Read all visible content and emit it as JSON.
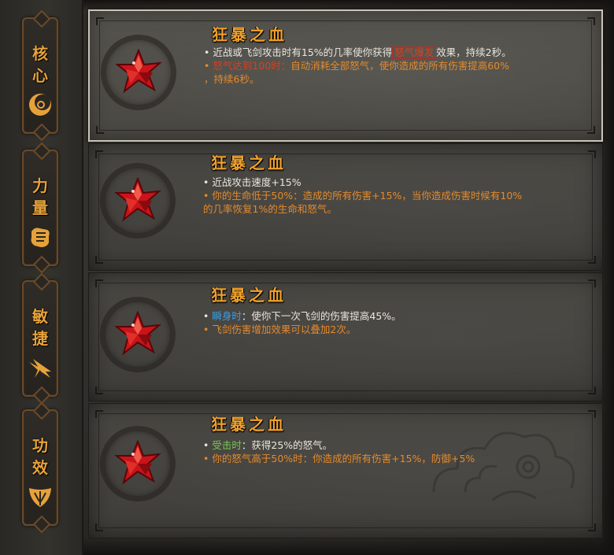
{
  "tabs": [
    {
      "label_1": "核",
      "label_2": "心",
      "icon": "crescent-swirl-icon"
    },
    {
      "label_1": "力",
      "label_2": "量",
      "icon": "fist-icon"
    },
    {
      "label_1": "敏",
      "label_2": "捷",
      "icon": "flying-sword-icon"
    },
    {
      "label_1": "功",
      "label_2": "效",
      "icon": "leaf-emblem-icon"
    }
  ],
  "panels": [
    {
      "title": "狂暴之血",
      "gem_icon": "red-crystal-star-icon",
      "lines": [
        {
          "a": "近战或飞剑攻击时有15%的几率使你获得",
          "b": "怒气爆发",
          "c": "效果，持续2秒。"
        },
        {
          "a": "怒气达到100时：",
          "b": "自动消耗全部怒气，使你造成的所有伤害提高60%"
        },
        {
          "a": "，持续6秒。"
        }
      ]
    },
    {
      "title": "狂暴之血",
      "gem_icon": "red-crystal-star-icon",
      "lines": [
        {
          "a": "近战攻击速度+15%"
        },
        {
          "a": "你的生命低于50%：造成的所有伤害+15%，当你造成伤害时候有10%"
        },
        {
          "a": "的几率恢复1%的生命和怒气。"
        }
      ]
    },
    {
      "title": "狂暴之血",
      "gem_icon": "red-crystal-star-icon",
      "lines": [
        {
          "a": "瞬身时",
          "b": "：使你下一次飞剑的伤害提高45%。"
        },
        {
          "a": "飞剑伤害增加效果可以叠加2次。"
        }
      ]
    },
    {
      "title": "狂暴之血",
      "gem_icon": "red-crystal-star-icon",
      "lines": [
        {
          "a": "受击时",
          "b": "：获得25%的怒气。"
        },
        {
          "a": "你的怒气高于50%时：你造成的所有伤害+15%，防御+5%"
        }
      ]
    }
  ],
  "colors": {
    "title_orange": "#f0a12e",
    "text_white": "#e9e6de",
    "text_orange": "#e48a2c",
    "text_red": "#d8401e",
    "text_blue": "#3aa0e8",
    "text_green": "#78c850",
    "tab_gold": "#e6a23a"
  }
}
